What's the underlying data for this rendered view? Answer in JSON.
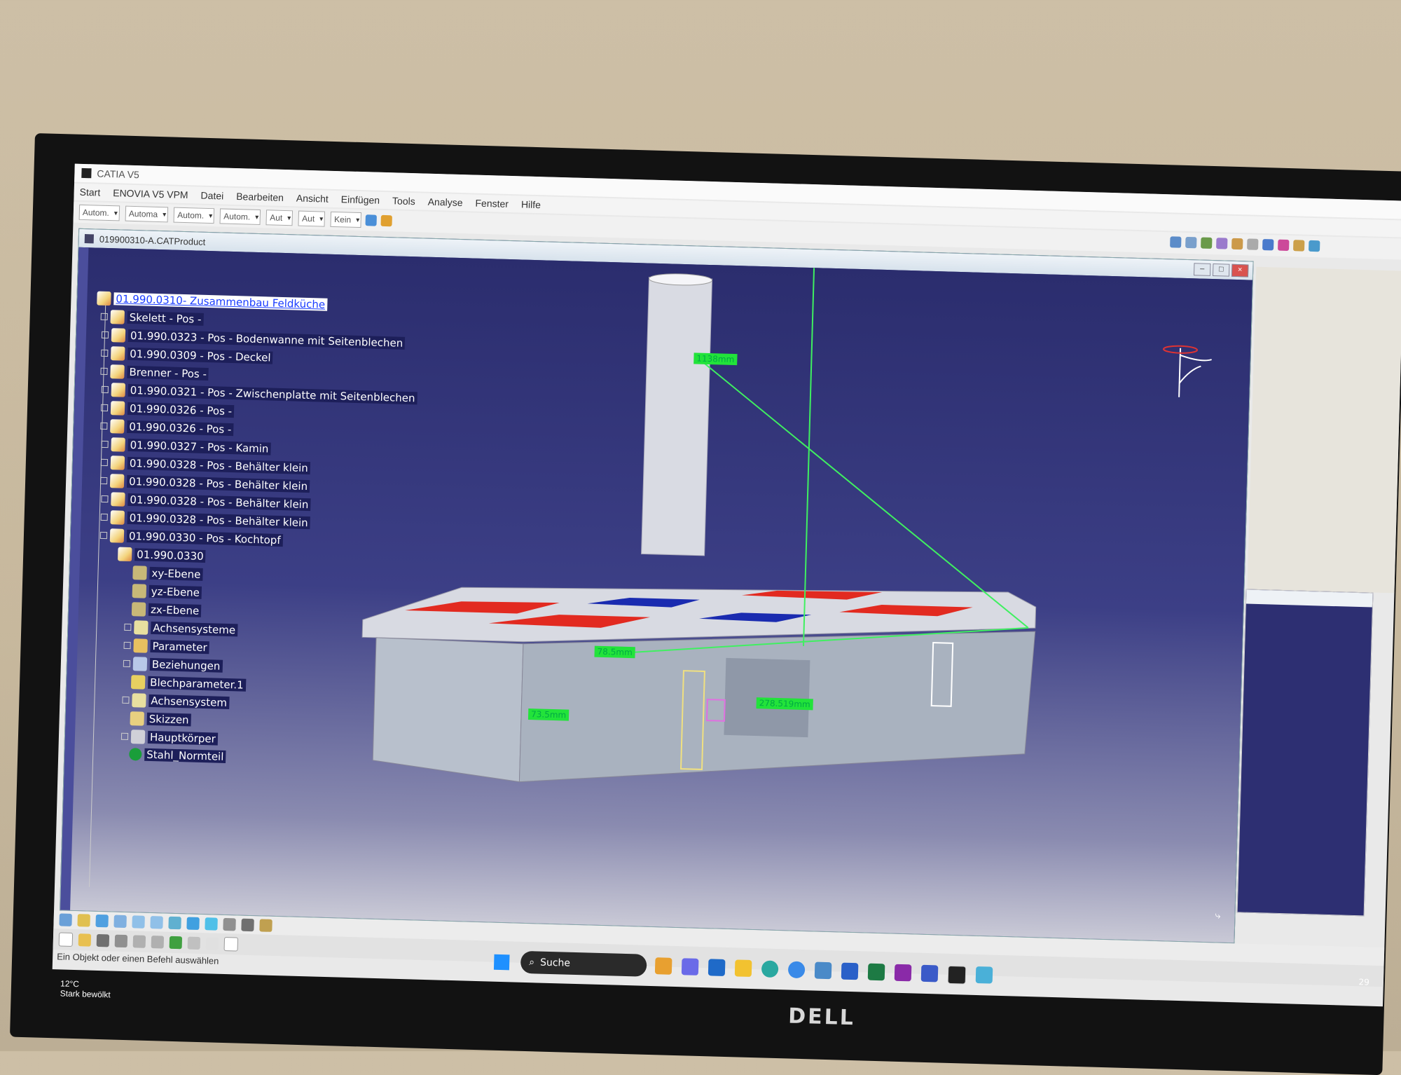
{
  "app": {
    "title": "CATIA V5",
    "menu": [
      "Start",
      "ENOVIA V5 VPM",
      "Datei",
      "Bearbeiten",
      "Ansicht",
      "Einfügen",
      "Tools",
      "Analyse",
      "Fenster",
      "Hilfe"
    ],
    "dropdowns": [
      "Autom.",
      "Automa",
      "Autom.",
      "Autom.",
      "Aut",
      "Aut",
      "Kein"
    ]
  },
  "document": {
    "title": "019900310-A.CATProduct",
    "tree": [
      {
        "label": "01.990.0310- Zusammenbau Feldküche",
        "selected": true
      },
      {
        "label": "Skelett - Pos  -"
      },
      {
        "label": "01.990.0323 - Pos  - Bodenwanne mit Seitenblechen"
      },
      {
        "label": "01.990.0309 - Pos  - Deckel"
      },
      {
        "label": "Brenner - Pos  -"
      },
      {
        "label": "01.990.0321 - Pos  - Zwischenplatte mit Seitenblechen"
      },
      {
        "label": "01.990.0326 - Pos  -"
      },
      {
        "label": "01.990.0326 - Pos  -"
      },
      {
        "label": "01.990.0327 - Pos  - Kamin"
      },
      {
        "label": "01.990.0328 - Pos  - Behälter klein"
      },
      {
        "label": "01.990.0328 - Pos  - Behälter klein"
      },
      {
        "label": "01.990.0328 - Pos  - Behälter klein"
      },
      {
        "label": "01.990.0328 - Pos  - Behälter klein"
      },
      {
        "label": "01.990.0330 - Pos  - Kochtopf"
      },
      {
        "label": "01.990.0330"
      },
      {
        "label": "xy-Ebene"
      },
      {
        "label": "yz-Ebene"
      },
      {
        "label": "zx-Ebene"
      },
      {
        "label": "Achsensysteme"
      },
      {
        "label": "Parameter"
      },
      {
        "label": "Beziehungen"
      },
      {
        "label": "Blechparameter.1"
      },
      {
        "label": "Achsensystem"
      },
      {
        "label": "Skizzen"
      },
      {
        "label": "Hauptkörper"
      },
      {
        "label": "Stahl_Normteil"
      }
    ],
    "dimensions": [
      "1138mm",
      "78.5mm",
      "73.5mm",
      "278.519mm"
    ]
  },
  "status_text": "Ein Objekt oder einen Befehl auswählen",
  "taskbar": {
    "search_label": "Suche",
    "weather_temp": "12°C",
    "weather_desc": "Stark bewölkt",
    "clock": "29"
  },
  "brand": "DELL",
  "colors": {
    "viewport_top": "#2b2d6e",
    "tree_selected": "#1a3cff",
    "dimension_label": "#22e33a",
    "burner_red": "#e22a20"
  }
}
